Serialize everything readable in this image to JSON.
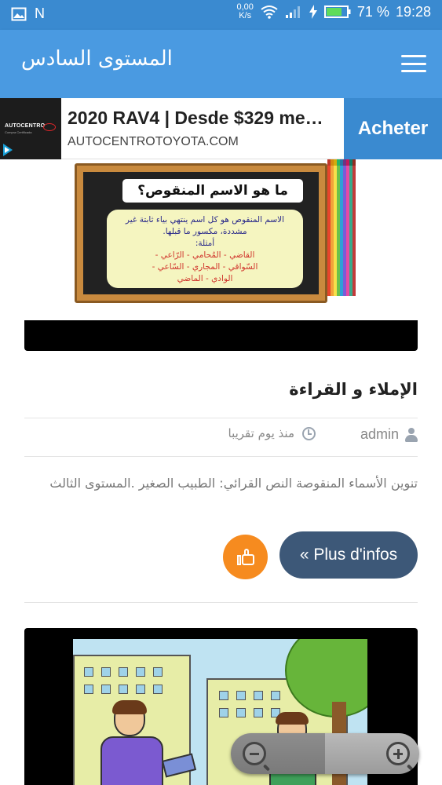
{
  "status_bar": {
    "left_icons": [
      "image-icon",
      "n-icon"
    ],
    "n_label": "N",
    "speed_value": "0,00",
    "speed_unit": "K/s",
    "battery": "71 %",
    "time": "19:28"
  },
  "app_bar": {
    "title": "المستوى السادس",
    "menu_icon": "hamburger-menu-icon",
    "color": "#4a9ae1"
  },
  "ad": {
    "logo_text": "AUTOCENTRO",
    "logo_subtext": "Compra Certificada",
    "title": "2020 RAV4 | Desde $329 me…",
    "domain": "AUTOCENTROTOYOTA.COM",
    "cta": "Acheter",
    "cta_color": "#3a8ad0"
  },
  "post1": {
    "image": {
      "board_title": "ما هو الاسم المنقوص؟",
      "board_definition": "الاسم المنقوص هو كل اسم ينتهي بياء ثابتة غير مشددة، مكسور ما قبلها.",
      "board_examples_label": "أمثلة:",
      "board_examples_1": "القاضي - المُحامي - الرّاعي -",
      "board_examples_2": "السّواقي - المجاري - السّاعي -",
      "board_examples_3": "الوادي - الماضي"
    },
    "title": "الإملاء و القراءة",
    "author": "admin",
    "date": "منذ يوم تقريبا",
    "excerpt": "تنوين الأسماء المنقوصة النص القرائي: الطبيب الصغير .المستوى الثالث",
    "more_label": "« Plus d'infos",
    "like_color": "#f68b1f",
    "more_color": "#3d5878"
  },
  "zoom": {
    "out_icon": "zoom-out-icon",
    "in_icon": "zoom-in-icon"
  }
}
